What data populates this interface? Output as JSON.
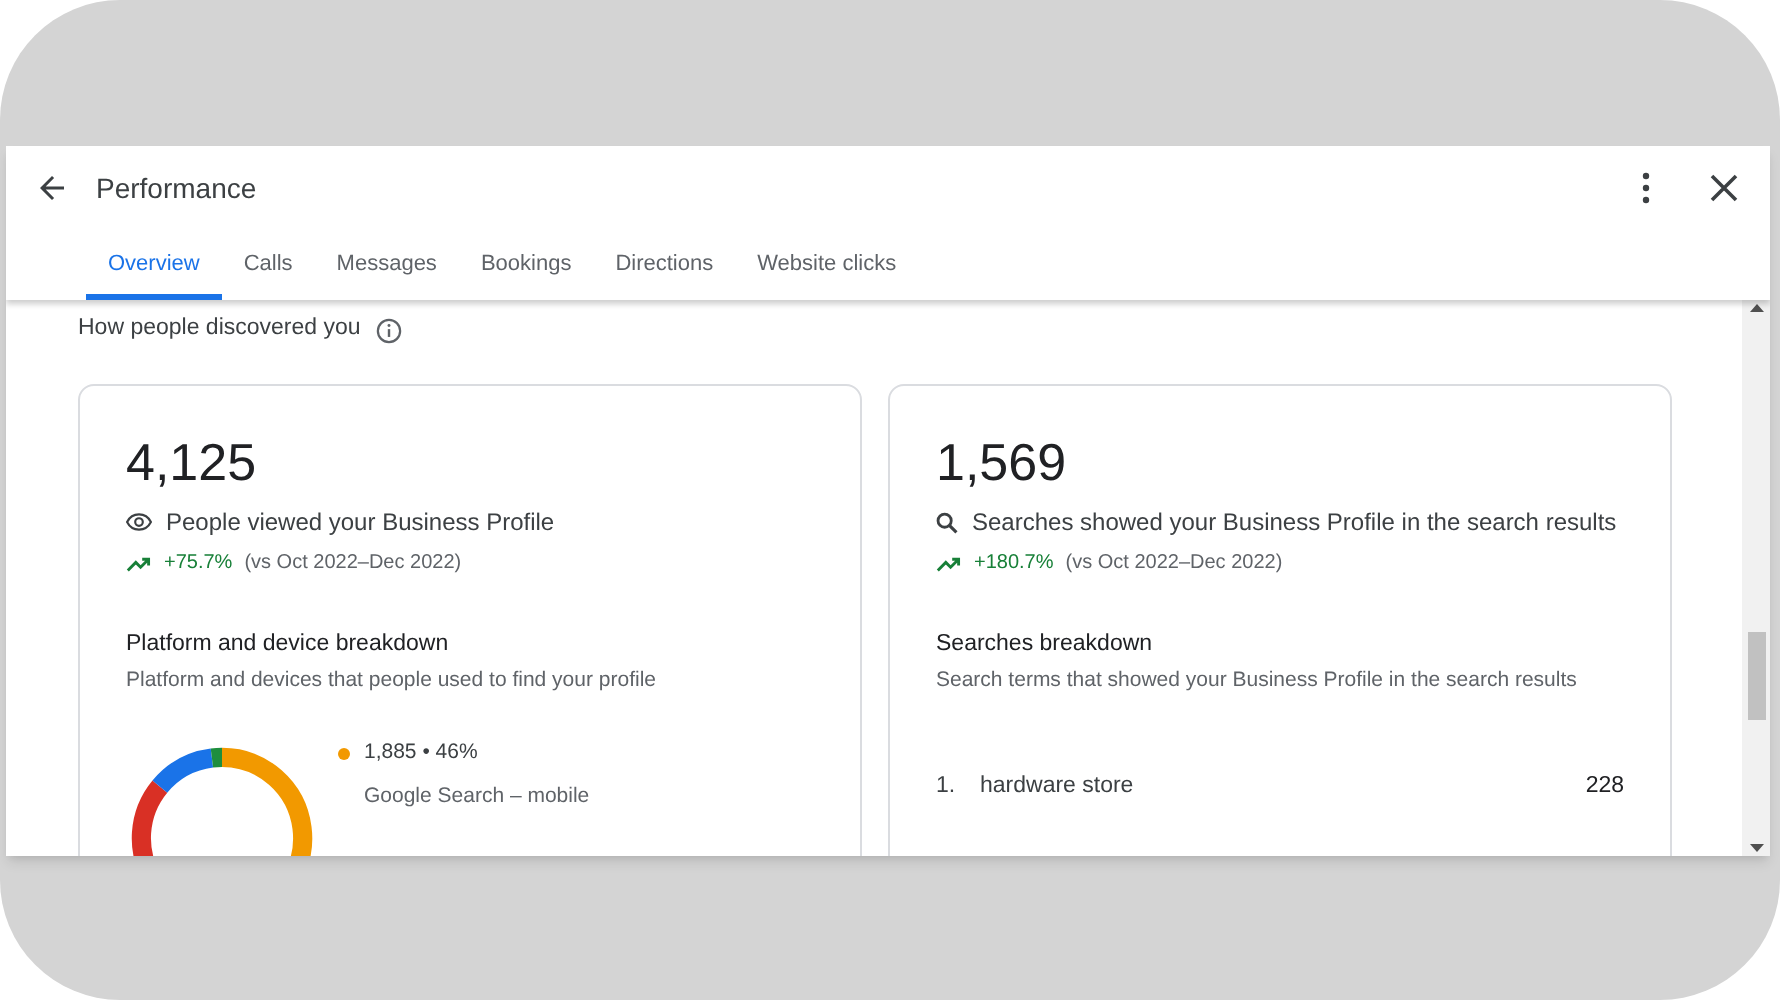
{
  "dialog": {
    "title": "Performance"
  },
  "tabs": [
    {
      "label": "Overview",
      "selected": true
    },
    {
      "label": "Calls",
      "selected": false
    },
    {
      "label": "Messages",
      "selected": false
    },
    {
      "label": "Bookings",
      "selected": false
    },
    {
      "label": "Directions",
      "selected": false
    },
    {
      "label": "Website clicks",
      "selected": false
    }
  ],
  "section_title": "How people discovered you",
  "cards": [
    {
      "kind": "views",
      "total": "4,125",
      "metric": "People viewed your Business Profile",
      "change": "+75.7%",
      "comparison": "(vs Oct 2022–Dec 2022)",
      "breakdown_title": "Platform and device breakdown",
      "breakdown_subtitle": "Platform and devices that people used to find your profile",
      "legend": [
        {
          "value": "1,885 • 46%",
          "label": "Google Search – mobile",
          "color": "#f29900"
        }
      ]
    },
    {
      "kind": "searches",
      "total": "1,569",
      "metric": "Searches showed your Business Profile in the search results",
      "change": "+180.7%",
      "comparison": "(vs Oct 2022–Dec 2022)",
      "breakdown_title": "Searches breakdown",
      "breakdown_subtitle": "Search terms that showed your Business Profile in the search results",
      "terms": [
        {
          "rank": "1.",
          "term": "hardware store",
          "count": "228"
        }
      ]
    }
  ]
}
